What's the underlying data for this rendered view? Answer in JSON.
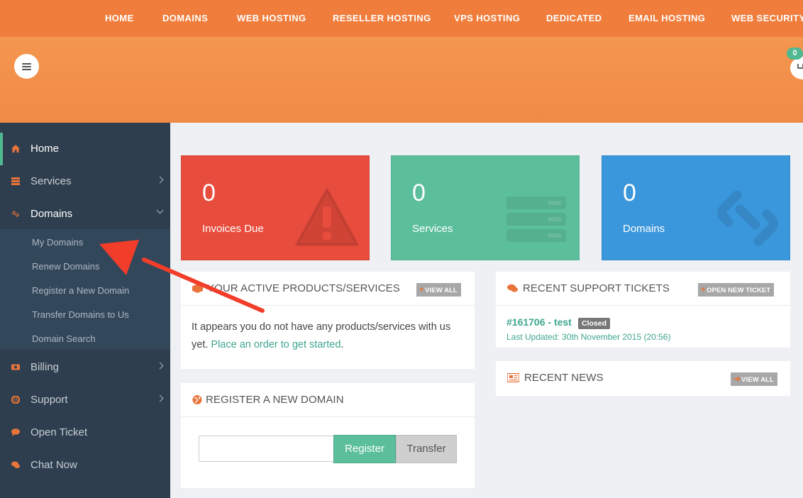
{
  "topnav": {
    "items": [
      "HOME",
      "DOMAINS",
      "WEB HOSTING",
      "RESELLER HOSTING",
      "VPS HOSTING",
      "DEDICATED",
      "EMAIL HOSTING",
      "WEB SECURITY"
    ]
  },
  "header": {
    "cart_count": "0"
  },
  "sidebar": {
    "items": [
      {
        "label": "Home",
        "icon": "home-icon"
      },
      {
        "label": "Services",
        "icon": "services-icon"
      },
      {
        "label": "Domains",
        "icon": "link-icon"
      },
      {
        "label": "Billing",
        "icon": "money-icon"
      },
      {
        "label": "Support",
        "icon": "lifebuoy-icon"
      },
      {
        "label": "Open Ticket",
        "icon": "comment-icon"
      },
      {
        "label": "Chat Now",
        "icon": "comments-icon"
      }
    ],
    "domains_submenu": [
      "My Domains",
      "Renew Domains",
      "Register a New Domain",
      "Transfer Domains to Us",
      "Domain Search"
    ]
  },
  "tiles": [
    {
      "value": "0",
      "label": "Invoices Due",
      "icon": "warning-icon",
      "color": "#e84c3d"
    },
    {
      "value": "0",
      "label": "Services",
      "icon": "server-icon",
      "color": "#5cbf9c"
    },
    {
      "value": "0",
      "label": "Domains",
      "icon": "link-icon",
      "color": "#3b97dc"
    }
  ],
  "products": {
    "title": "YOUR ACTIVE PRODUCTS/SERVICES",
    "button": "VIEW ALL",
    "text": "It appears you do not have any products/services with us yet.",
    "link": "Place an order to get started",
    "link_suffix": "."
  },
  "register": {
    "title": "REGISTER A NEW DOMAIN",
    "register_label": "Register",
    "transfer_label": "Transfer"
  },
  "tickets": {
    "title": "RECENT SUPPORT TICKETS",
    "button": "OPEN NEW TICKET",
    "ticket_id": "#161706 - test",
    "status": "Closed",
    "updated": "Last Updated: 30th November 2015 (20:56)"
  },
  "news": {
    "title": "RECENT NEWS",
    "button": "VIEW ALL"
  },
  "colors": {
    "accent_orange": "#f07d3c",
    "accent_green": "#5cbf9c",
    "sidebar_bg": "#2e3e4e"
  }
}
